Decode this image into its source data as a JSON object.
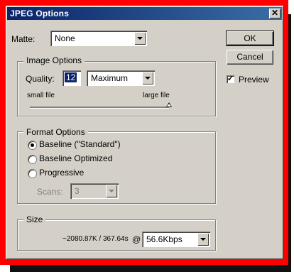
{
  "dialog": {
    "title": "JPEG Options",
    "close_glyph": "✕"
  },
  "matte": {
    "label": "Matte:",
    "value": "None"
  },
  "image_options": {
    "legend": "Image Options",
    "quality_label": "Quality:",
    "quality_value": "12",
    "quality_preset": "Maximum",
    "slider_min_label": "small file",
    "slider_max_label": "large file",
    "slider_level": 1.0
  },
  "format_options": {
    "legend": "Format Options",
    "options": [
      {
        "label": "Baseline (\"Standard\")",
        "selected": true
      },
      {
        "label": "Baseline Optimized",
        "selected": false
      },
      {
        "label": "Progressive",
        "selected": false
      }
    ],
    "scans_label": "Scans:",
    "scans_value": "3"
  },
  "size": {
    "legend": "Size",
    "estimate": "~2080.87K / 367.64s",
    "at": "@",
    "speed": "56.6Kbps"
  },
  "buttons": {
    "ok": "OK",
    "cancel": "Cancel"
  },
  "preview": {
    "label": "Preview",
    "checked": true,
    "check_glyph": "✓"
  },
  "colors": {
    "highlight_frame": "#ff0000",
    "title_bar": "#0a246a",
    "dialog_face": "#d4d0c8"
  }
}
